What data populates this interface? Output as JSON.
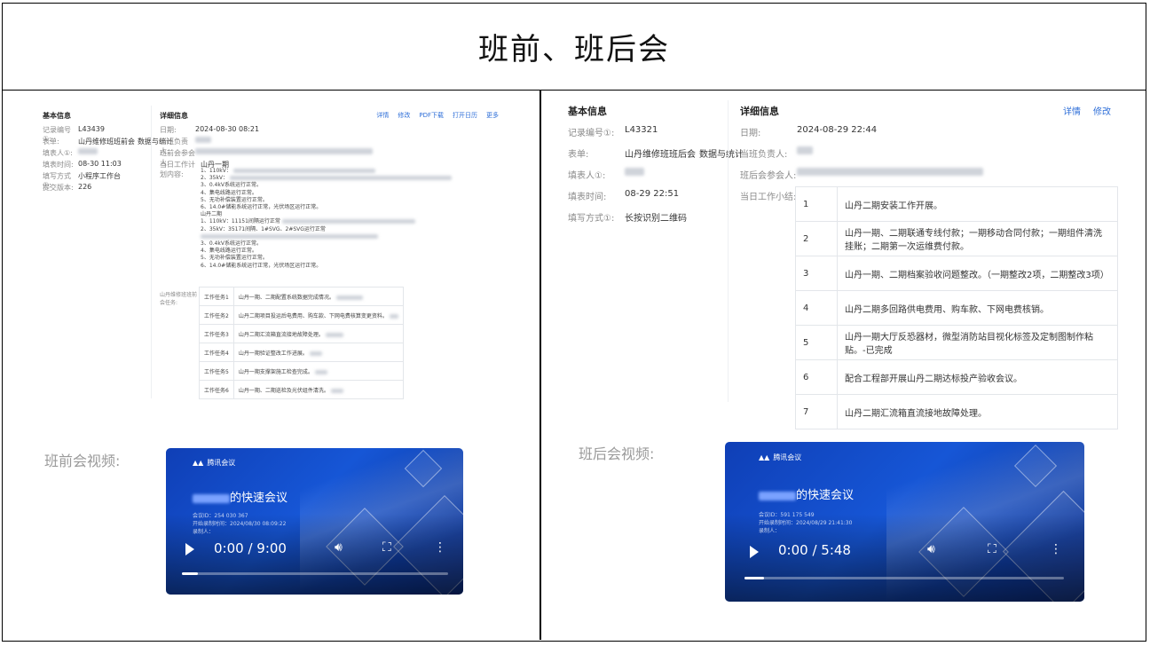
{
  "page": {
    "title": "班前、班后会"
  },
  "left_record": {
    "basic": {
      "title": "基本信息",
      "rows": [
        {
          "label": "记录编号①:",
          "value": "L43439"
        },
        {
          "label": "表单:",
          "value": "山丹维修班班前会",
          "link": "数据与统计"
        },
        {
          "label": "填表人①:",
          "value": "",
          "blurred": true
        },
        {
          "label": "填表时间:",
          "value": "08-30 11:03"
        },
        {
          "label": "填写方式①:",
          "value": "小程序工作台"
        },
        {
          "label": "提交版本:",
          "value": "226"
        }
      ]
    },
    "detail": {
      "title": "详细信息",
      "date_label": "日期:",
      "date_value": "2024-08-30 08:21",
      "actions": [
        "详情",
        "修改",
        "PDF下载",
        "打开日历",
        "更多"
      ],
      "rows": [
        {
          "label": "当班负责人:"
        },
        {
          "label": "班前会参会人:"
        },
        {
          "label": "当日工作计划内容:",
          "value": "山丹一期"
        }
      ],
      "list": [
        "1、110kV：",
        "2、35kV：",
        "3、0.4kV系统运行正常。",
        "4、集电线路运行正常。",
        "5、无功补偿装置运行正常。",
        "6、14.0#储能系统运行正常，光伏场区运行正常。",
        "山丹二期",
        "1、110kV：11151间隔运行正常",
        "2、35kV：35171间隔、1#SVG、2#SVG运行正常",
        "3、0.4kV系统运行正常。",
        "4、集电线路运行正常。",
        "5、无功补偿装置运行正常。",
        "6、14.0#储能系统运行正常，光伏场区运行正常。"
      ],
      "tasks_label": "山丹维修班班前会任务:",
      "tasks": [
        {
          "k": "工作任务1",
          "v": "山丹一期、二期配置系统数据完成情况。"
        },
        {
          "k": "工作任务2",
          "v": "山丹二期项目投运后电费用、购车款、下网电费核算变更资料。"
        },
        {
          "k": "工作任务3",
          "v": "山丹二期汇流箱直流接地故障处理。"
        },
        {
          "k": "工作任务4",
          "v": "山丹一期验证整改工作进展。"
        },
        {
          "k": "工作任务5",
          "v": "山丹一期支撑架施工检查完成。"
        },
        {
          "k": "工作任务6",
          "v": "山丹一期、二期巡检及光伏组件清洗。"
        }
      ]
    }
  },
  "right_record": {
    "basic": {
      "title": "基本信息",
      "rows": [
        {
          "label": "记录编号①:",
          "value": "L43321"
        },
        {
          "label": "表单:",
          "value": "山丹维修班班后会",
          "link": "数据与统计"
        },
        {
          "label": "填表人①:",
          "value": "",
          "blurred": true
        },
        {
          "label": "填表时间:",
          "value": "08-29 22:51"
        },
        {
          "label": "填写方式①:",
          "value": "长按识别二维码"
        }
      ]
    },
    "detail": {
      "title": "详细信息",
      "actions": [
        "详情",
        "修改"
      ],
      "rows": [
        {
          "label": "日期:",
          "value": "2024-08-29 22:44"
        },
        {
          "label": "当班负责人:",
          "value": "",
          "blurred": true
        },
        {
          "label": "班后会参会人:",
          "value": "",
          "blurred": true
        }
      ],
      "work_label": "当日工作小结:",
      "work": [
        {
          "n": "1",
          "text": "山丹二期安装工作开展。"
        },
        {
          "n": "2",
          "text": "山丹一期、二期联通专线付款；一期移动合同付款；一期组件清洗挂账；二期第一次运维费付款。"
        },
        {
          "n": "3",
          "text": "山丹一期、二期档案验收问题整改。（一期整改2项，二期整改3项）"
        },
        {
          "n": "4",
          "text": "山丹二期多回路供电费用、购车款、下网电费核销。"
        },
        {
          "n": "5",
          "text": "山丹一期大厅反恐器材，微型消防站目视化标签及定制图制作粘贴。-已完成"
        },
        {
          "n": "6",
          "text": "配合工程部开展山丹二期达标投产验收会议。"
        },
        {
          "n": "7",
          "text": "山丹二期汇流箱直流接地故障处理。"
        }
      ]
    }
  },
  "videos": [
    {
      "label": "班前会视频:",
      "brand": "腾讯会议",
      "meeting_title_suffix": "的快速会议",
      "meta_line1": "会议ID：254 030 367",
      "meta_line2": "开始录制时间：2024/08/30 08:09:22",
      "meta_line3": "录制人：",
      "time": "0:00 / 9:00",
      "progress": 0.0
    },
    {
      "label": "班后会视频:",
      "brand": "腾讯会议",
      "meeting_title_suffix": "的快速会议",
      "meta_line1": "会议ID：591 175 549",
      "meta_line2": "开始录制时间：2024/08/29 21:41:30",
      "meta_line3": "录制人：",
      "time": "0:00 / 5:48",
      "progress": 0.0
    }
  ]
}
